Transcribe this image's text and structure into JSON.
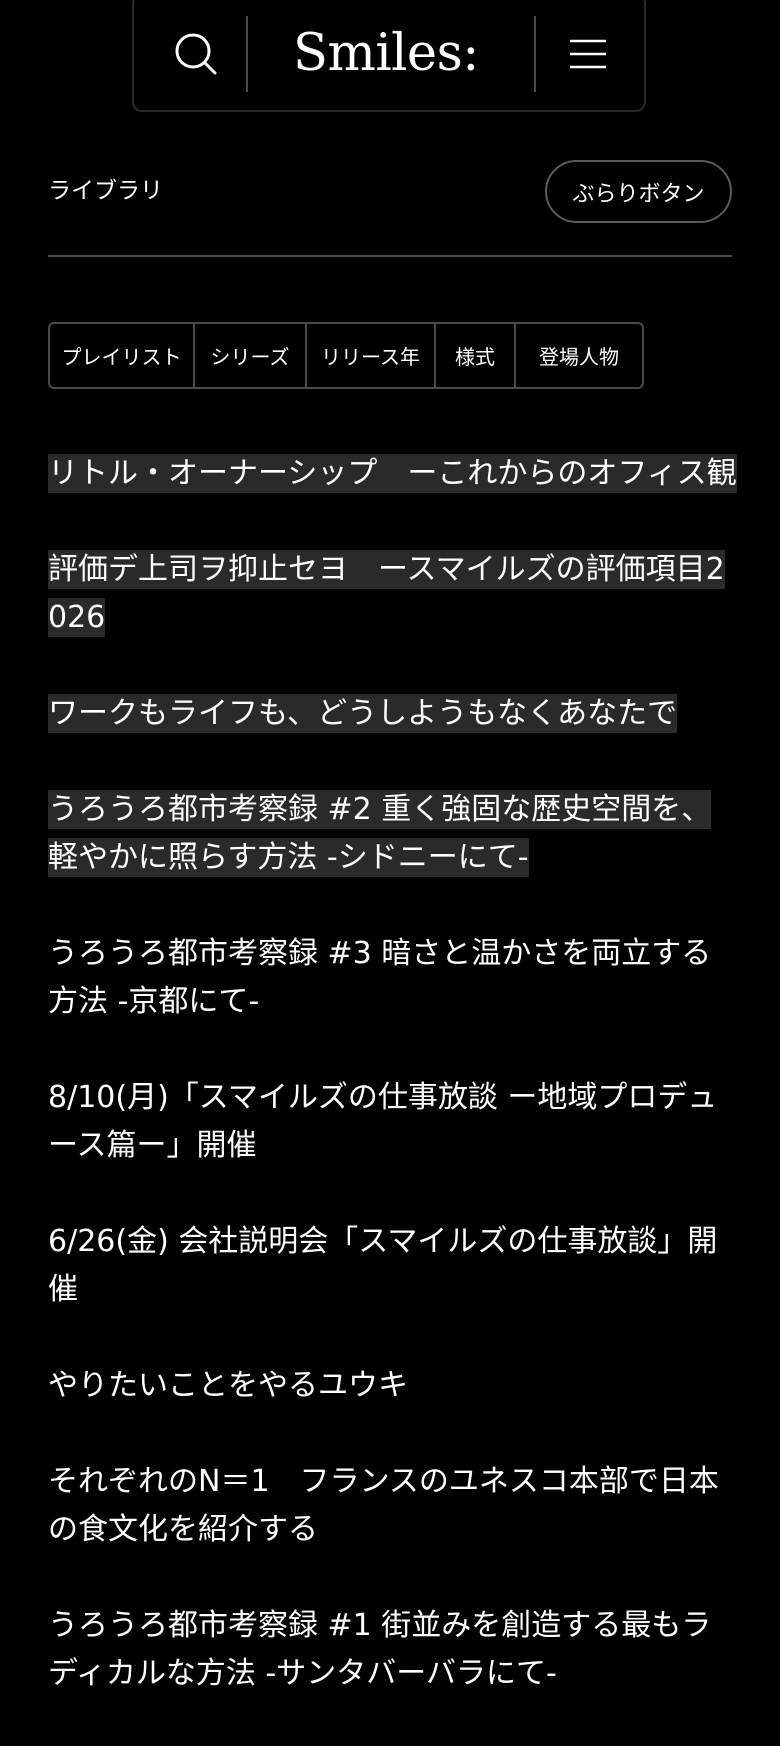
{
  "header": {
    "logo": "Smiles:",
    "search_icon": "search-icon",
    "menu_icon": "hamburger-menu-icon"
  },
  "library": {
    "label": "ライブラリ",
    "button_label": "ぶらりボタン"
  },
  "filters": [
    {
      "label": "プレイリスト"
    },
    {
      "label": "シリーズ"
    },
    {
      "label": "リリース年"
    },
    {
      "label": "様式"
    },
    {
      "label": "登場人物"
    }
  ],
  "articles": [
    {
      "title": "リトル・オーナーシップ　ーこれからのオフィス観",
      "highlighted": true
    },
    {
      "title": "評価デ上司ヲ抑止セヨ　ースマイルズの評価項目2026",
      "highlighted": true
    },
    {
      "title": "ワークもライフも、どうしようもなくあなたで",
      "highlighted": true
    },
    {
      "title": "うろうろ都市考察録 #2 重く強固な歴史空間を、軽やかに照らす方法 -シドニーにて-",
      "highlighted": true
    },
    {
      "title": "うろうろ都市考察録 #3 暗さと温かさを両立する方法 -京都にて-",
      "highlighted": false
    },
    {
      "title": "8/10(月)「スマイルズの仕事放談 ー地域プロデュース篇ー」開催",
      "highlighted": false
    },
    {
      "title": "6/26(金) 会社説明会「スマイルズの仕事放談」開催",
      "highlighted": false
    },
    {
      "title": "やりたいことをやるユウキ",
      "highlighted": false
    },
    {
      "title": "それぞれのN＝1　フランスのユネスコ本部で日本の食文化を紹介する",
      "highlighted": false
    },
    {
      "title": "うろうろ都市考察録 #1 街並みを創造する最もラディカルな方法 -サンタバーバラにて-",
      "highlighted": false
    }
  ],
  "colors": {
    "background": "#000000",
    "text": "#ffffff",
    "highlight": "#2a2a2a",
    "border": "#4a4a4a"
  }
}
